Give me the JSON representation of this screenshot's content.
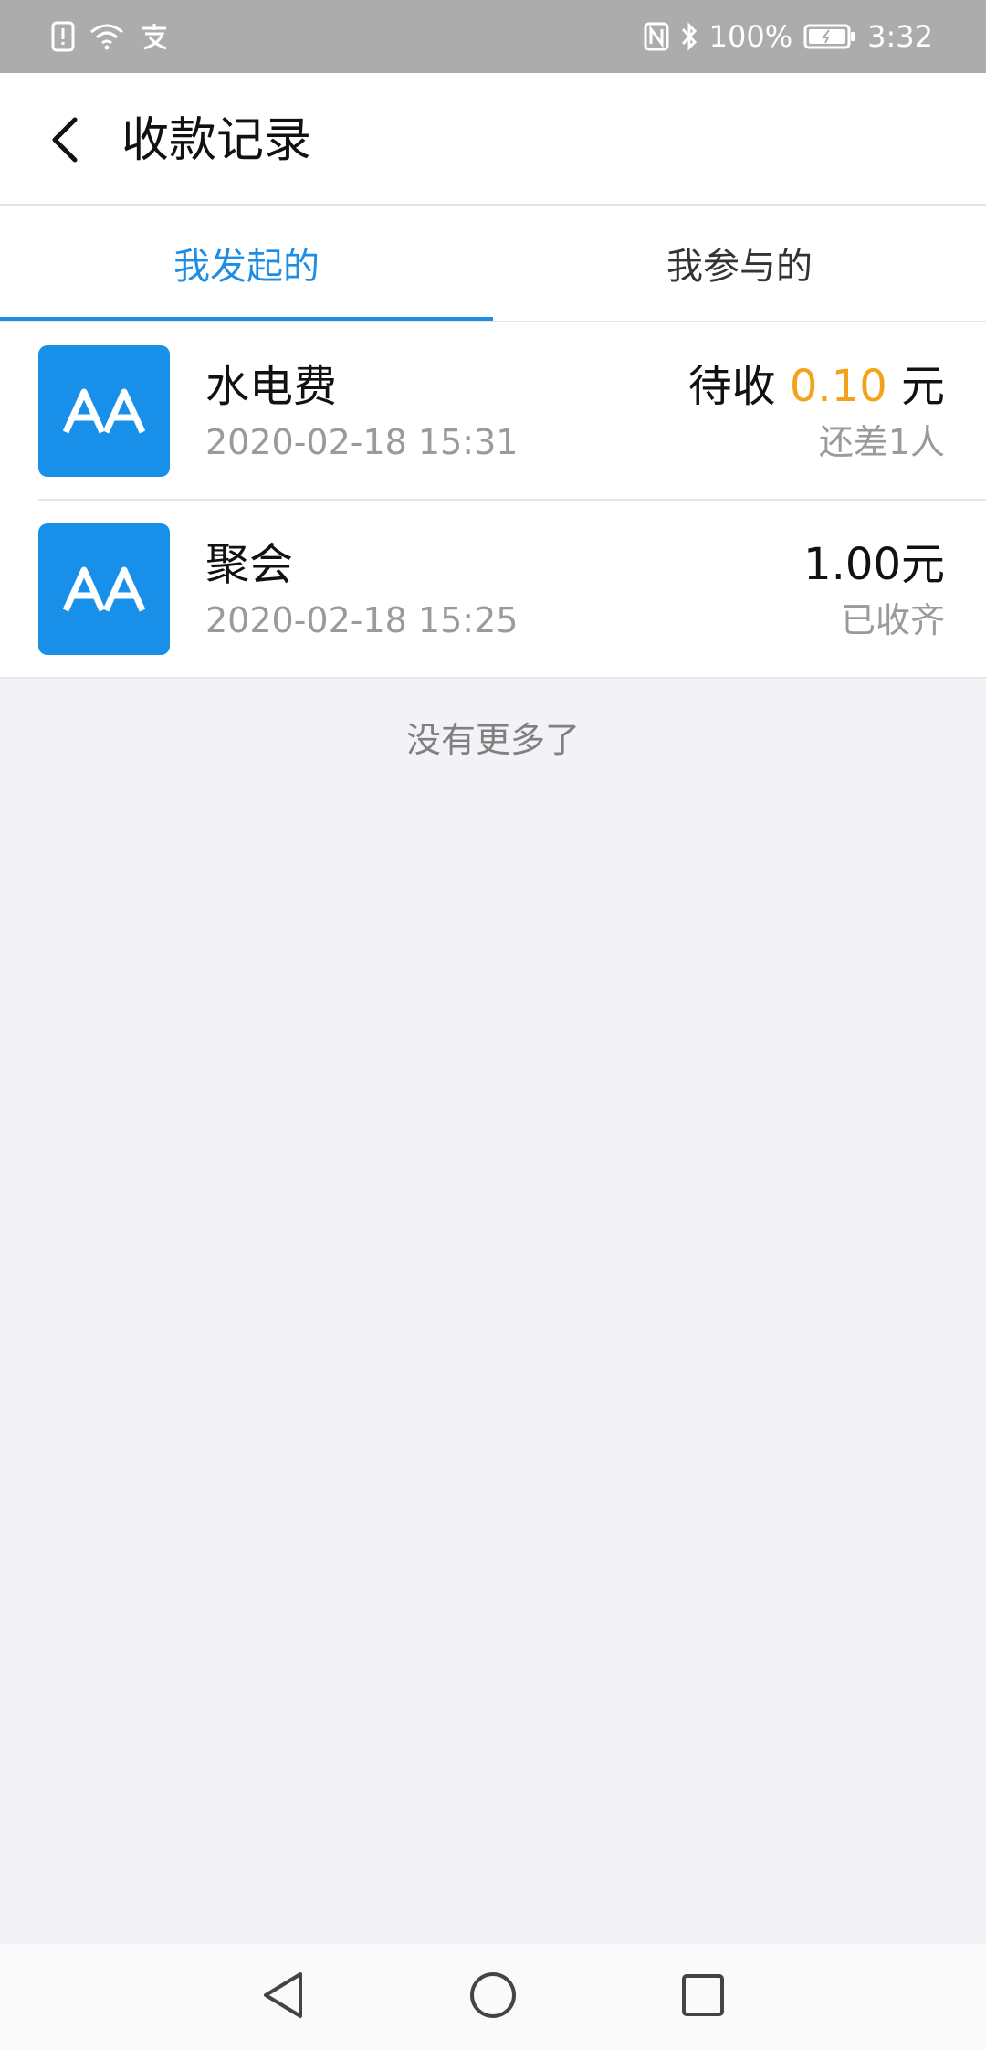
{
  "status_bar": {
    "battery": "100%",
    "time": "3:32",
    "icons": [
      "sim-alert-icon",
      "wifi-icon",
      "alipay-icon",
      "nfc-icon",
      "bluetooth-icon",
      "battery-icon"
    ]
  },
  "header": {
    "title": "收款记录",
    "back_icon": "chevron-left-icon"
  },
  "tabs": [
    {
      "label": "我发起的",
      "active": true
    },
    {
      "label": "我参与的",
      "active": false
    }
  ],
  "records": [
    {
      "icon_text": "AA",
      "title": "水电费",
      "time": "2020-02-18 15:31",
      "amount_prefix": "待收 ",
      "amount": "0.10",
      "amount_suffix": " 元",
      "status": "还差1人"
    },
    {
      "icon_text": "AA",
      "title": "聚会",
      "time": "2020-02-18 15:25",
      "amount": "1.00元",
      "status": "已收齐"
    }
  ],
  "footer_text": "没有更多了",
  "colors": {
    "accent": "#1e8de3",
    "pending_amount": "#f3a31b",
    "thumb_bg": "#1890ea",
    "page_bg": "#f2f2f7"
  },
  "nav": [
    "back-triangle-icon",
    "home-circle-icon",
    "recents-square-icon"
  ]
}
